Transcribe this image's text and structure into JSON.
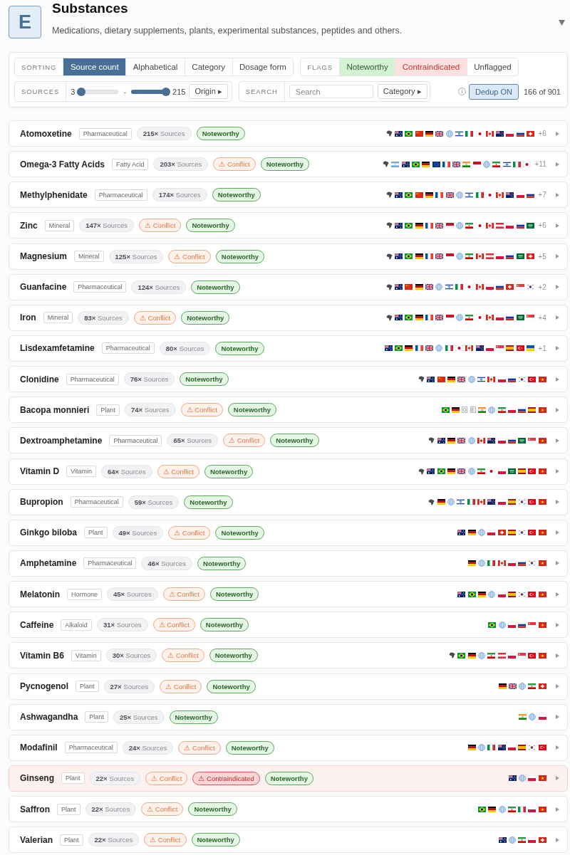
{
  "header": {
    "logo": "E",
    "title": "Substances",
    "subtitle": "Medications, dietary supplements, plants, experimental substances, peptides and others."
  },
  "sorting": {
    "label": "SORTING",
    "options": [
      {
        "label": "Source count",
        "selected": true
      },
      {
        "label": "Alphabetical",
        "selected": false
      },
      {
        "label": "Category",
        "selected": false
      },
      {
        "label": "Dosage form",
        "selected": false
      }
    ]
  },
  "flags_filter": {
    "label": "FLAGS",
    "options": [
      {
        "kind": "noteworthy",
        "label": "Noteworthy",
        "selected": true
      },
      {
        "kind": "contraindicated",
        "label": "Contraindicated",
        "selected": true
      },
      {
        "kind": "unflagged",
        "label": "Unflagged",
        "selected": false
      }
    ]
  },
  "sources": {
    "label": "SOURCES",
    "min": "3",
    "min_slider": {
      "level": 0
    },
    "separator": "-",
    "max_slider": {
      "level": 1
    },
    "max": "215",
    "origin_button": "Origin ▸"
  },
  "search": {
    "label": "SEARCH",
    "placeholder": "Search",
    "category_button": "Category ▸"
  },
  "dedup": {
    "label": "Dedup ON",
    "on": true
  },
  "count": "166 of 901",
  "rows": [
    {
      "name": "Atomoxetine",
      "category": "Pharmaceutical",
      "sources": "**215×** Sources",
      "highlighted": false,
      "tags": [
        {
          "kind": "noteworthy",
          "label": "Noteworthy"
        }
      ],
      "flags": [
        {
          "kind": "africa"
        },
        {
          "kind": "australia"
        },
        {
          "kind": "brazil"
        },
        {
          "kind": "china"
        },
        {
          "kind": "germany"
        },
        {
          "kind": "united-kingdom"
        },
        {
          "kind": "globe"
        },
        {
          "kind": "israel"
        },
        {
          "kind": "italy"
        },
        {
          "kind": "japan"
        },
        {
          "kind": "canada"
        },
        {
          "kind": "new-zealand"
        },
        {
          "kind": "poland"
        },
        {
          "kind": "russia"
        },
        {
          "kind": "switzerland"
        }
      ],
      "more": "+6"
    },
    {
      "name": "Omega-3 Fatty Acids",
      "category": "Fatty Acid",
      "sources": "**203×** Sources",
      "highlighted": false,
      "tags": [
        {
          "kind": "conflict",
          "label": "⚠ Conflict"
        },
        {
          "kind": "noteworthy",
          "label": "Noteworthy"
        }
      ],
      "flags": [
        {
          "kind": "africa"
        },
        {
          "kind": "argentina"
        },
        {
          "kind": "australia"
        },
        {
          "kind": "brazil"
        },
        {
          "kind": "germany"
        },
        {
          "kind": "european-union"
        },
        {
          "kind": "france"
        },
        {
          "kind": "united-kingdom"
        },
        {
          "kind": "india"
        },
        {
          "kind": "indonesia"
        },
        {
          "kind": "globe"
        },
        {
          "kind": "iran"
        },
        {
          "kind": "israel"
        },
        {
          "kind": "italy"
        },
        {
          "kind": "japan"
        }
      ],
      "more": "+11"
    },
    {
      "name": "Methylphenidate",
      "category": "Pharmaceutical",
      "sources": "**174×** Sources",
      "highlighted": false,
      "tags": [
        {
          "kind": "noteworthy",
          "label": "Noteworthy"
        }
      ],
      "flags": [
        {
          "kind": "africa"
        },
        {
          "kind": "australia"
        },
        {
          "kind": "brazil"
        },
        {
          "kind": "china"
        },
        {
          "kind": "germany"
        },
        {
          "kind": "france"
        },
        {
          "kind": "united-kingdom"
        },
        {
          "kind": "globe"
        },
        {
          "kind": "israel"
        },
        {
          "kind": "italy"
        },
        {
          "kind": "japan"
        },
        {
          "kind": "canada"
        },
        {
          "kind": "new-zealand"
        },
        {
          "kind": "poland"
        },
        {
          "kind": "russia"
        }
      ],
      "more": "+7"
    },
    {
      "name": "Zinc",
      "category": "Mineral",
      "sources": "**147×** Sources",
      "highlighted": false,
      "tags": [
        {
          "kind": "conflict",
          "label": "⚠ Conflict"
        },
        {
          "kind": "noteworthy",
          "label": "Noteworthy"
        }
      ],
      "flags": [
        {
          "kind": "africa"
        },
        {
          "kind": "australia"
        },
        {
          "kind": "brazil"
        },
        {
          "kind": "germany"
        },
        {
          "kind": "france"
        },
        {
          "kind": "united-kingdom"
        },
        {
          "kind": "indonesia"
        },
        {
          "kind": "globe"
        },
        {
          "kind": "iran"
        },
        {
          "kind": "japan"
        },
        {
          "kind": "canada"
        },
        {
          "kind": "austria"
        },
        {
          "kind": "poland"
        },
        {
          "kind": "russia"
        },
        {
          "kind": "saudi-arabia"
        }
      ],
      "more": "+6"
    },
    {
      "name": "Magnesium",
      "category": "Mineral",
      "sources": "**125×** Sources",
      "highlighted": false,
      "tags": [
        {
          "kind": "conflict",
          "label": "⚠ Conflict"
        },
        {
          "kind": "noteworthy",
          "label": "Noteworthy"
        }
      ],
      "flags": [
        {
          "kind": "africa"
        },
        {
          "kind": "australia"
        },
        {
          "kind": "brazil"
        },
        {
          "kind": "germany"
        },
        {
          "kind": "france"
        },
        {
          "kind": "united-kingdom"
        },
        {
          "kind": "indonesia"
        },
        {
          "kind": "globe"
        },
        {
          "kind": "iran"
        },
        {
          "kind": "canada"
        },
        {
          "kind": "austria"
        },
        {
          "kind": "poland"
        },
        {
          "kind": "russia"
        },
        {
          "kind": "saudi-arabia"
        },
        {
          "kind": "switzerland"
        }
      ],
      "more": "+5"
    },
    {
      "name": "Guanfacine",
      "category": "Pharmaceutical",
      "sources": "**124×** Sources",
      "highlighted": false,
      "tags": [
        {
          "kind": "noteworthy",
          "label": "Noteworthy"
        }
      ],
      "flags": [
        {
          "kind": "africa"
        },
        {
          "kind": "australia"
        },
        {
          "kind": "china"
        },
        {
          "kind": "germany"
        },
        {
          "kind": "united-kingdom"
        },
        {
          "kind": "globe"
        },
        {
          "kind": "israel"
        },
        {
          "kind": "italy"
        },
        {
          "kind": "japan"
        },
        {
          "kind": "canada"
        },
        {
          "kind": "poland"
        },
        {
          "kind": "russia"
        },
        {
          "kind": "switzerland"
        },
        {
          "kind": "singapore"
        },
        {
          "kind": "south-korea"
        }
      ],
      "more": "+2"
    },
    {
      "name": "Iron",
      "category": "Mineral",
      "sources": "**83×** Sources",
      "highlighted": false,
      "tags": [
        {
          "kind": "conflict",
          "label": "⚠ Conflict"
        },
        {
          "kind": "noteworthy",
          "label": "Noteworthy"
        }
      ],
      "flags": [
        {
          "kind": "africa"
        },
        {
          "kind": "australia"
        },
        {
          "kind": "brazil"
        },
        {
          "kind": "germany"
        },
        {
          "kind": "france"
        },
        {
          "kind": "united-kingdom"
        },
        {
          "kind": "indonesia"
        },
        {
          "kind": "globe"
        },
        {
          "kind": "iran"
        },
        {
          "kind": "japan"
        },
        {
          "kind": "canada"
        },
        {
          "kind": "poland"
        },
        {
          "kind": "russia"
        },
        {
          "kind": "saudi-arabia"
        },
        {
          "kind": "singapore"
        }
      ],
      "more": "+4"
    },
    {
      "name": "Lisdexamfetamine",
      "category": "Pharmaceutical",
      "sources": "**80×** Sources",
      "highlighted": false,
      "tags": [
        {
          "kind": "noteworthy",
          "label": "Noteworthy"
        }
      ],
      "flags": [
        {
          "kind": "australia"
        },
        {
          "kind": "brazil"
        },
        {
          "kind": "germany"
        },
        {
          "kind": "france"
        },
        {
          "kind": "united-kingdom"
        },
        {
          "kind": "globe"
        },
        {
          "kind": "italy"
        },
        {
          "kind": "japan"
        },
        {
          "kind": "canada"
        },
        {
          "kind": "new-zealand"
        },
        {
          "kind": "poland"
        },
        {
          "kind": "singapore"
        },
        {
          "kind": "spain"
        },
        {
          "kind": "turkey"
        },
        {
          "kind": "ukraine"
        }
      ],
      "more": "+1"
    },
    {
      "name": "Clonidine",
      "category": "Pharmaceutical",
      "sources": "**76×** Sources",
      "highlighted": false,
      "tags": [
        {
          "kind": "noteworthy",
          "label": "Noteworthy"
        }
      ],
      "flags": [
        {
          "kind": "africa"
        },
        {
          "kind": "australia"
        },
        {
          "kind": "china"
        },
        {
          "kind": "germany"
        },
        {
          "kind": "united-kingdom"
        },
        {
          "kind": "globe"
        },
        {
          "kind": "israel"
        },
        {
          "kind": "canada"
        },
        {
          "kind": "poland"
        },
        {
          "kind": "russia"
        },
        {
          "kind": "south-korea"
        },
        {
          "kind": "turkey"
        },
        {
          "kind": "vietnam"
        }
      ]
    },
    {
      "name": "Bacopa monnieri",
      "category": "Plant",
      "sources": "**74×** Sources",
      "highlighted": false,
      "tags": [
        {
          "kind": "conflict",
          "label": "⚠ Conflict"
        },
        {
          "kind": "noteworthy",
          "label": "Noteworthy"
        }
      ],
      "flags": [
        {
          "kind": "brazil"
        },
        {
          "kind": "germany"
        },
        {
          "kind": "letter",
          "text": "G"
        },
        {
          "kind": "letter",
          "text": "E"
        },
        {
          "kind": "india"
        },
        {
          "kind": "globe"
        },
        {
          "kind": "iran"
        },
        {
          "kind": "poland"
        },
        {
          "kind": "russia"
        },
        {
          "kind": "spain"
        },
        {
          "kind": "vietnam"
        }
      ]
    },
    {
      "name": "Dextroamphetamine",
      "category": "Pharmaceutical",
      "sources": "**65×** Sources",
      "highlighted": false,
      "tags": [
        {
          "kind": "conflict",
          "label": "⚠ Conflict"
        },
        {
          "kind": "noteworthy",
          "label": "Noteworthy"
        }
      ],
      "flags": [
        {
          "kind": "africa"
        },
        {
          "kind": "australia"
        },
        {
          "kind": "germany"
        },
        {
          "kind": "united-kingdom"
        },
        {
          "kind": "globe"
        },
        {
          "kind": "canada"
        },
        {
          "kind": "new-zealand"
        },
        {
          "kind": "poland"
        },
        {
          "kind": "russia"
        },
        {
          "kind": "saudi-arabia"
        },
        {
          "kind": "singapore"
        },
        {
          "kind": "vietnam"
        }
      ]
    },
    {
      "name": "Vitamin D",
      "category": "Vitamin",
      "sources": "**64×** Sources",
      "highlighted": false,
      "tags": [
        {
          "kind": "conflict",
          "label": "⚠ Conflict"
        },
        {
          "kind": "noteworthy",
          "label": "Noteworthy"
        }
      ],
      "flags": [
        {
          "kind": "africa"
        },
        {
          "kind": "australia"
        },
        {
          "kind": "brazil"
        },
        {
          "kind": "germany"
        },
        {
          "kind": "united-kingdom"
        },
        {
          "kind": "globe"
        },
        {
          "kind": "iran"
        },
        {
          "kind": "japan"
        },
        {
          "kind": "poland"
        },
        {
          "kind": "saudi-arabia"
        },
        {
          "kind": "spain"
        },
        {
          "kind": "turkey"
        },
        {
          "kind": "vietnam"
        }
      ]
    },
    {
      "name": "Bupropion",
      "category": "Pharmaceutical",
      "sources": "**59×** Sources",
      "highlighted": false,
      "tags": [
        {
          "kind": "noteworthy",
          "label": "Noteworthy"
        }
      ],
      "flags": [
        {
          "kind": "africa"
        },
        {
          "kind": "germany"
        },
        {
          "kind": "globe"
        },
        {
          "kind": "israel"
        },
        {
          "kind": "italy"
        },
        {
          "kind": "canada"
        },
        {
          "kind": "new-zealand"
        },
        {
          "kind": "poland"
        },
        {
          "kind": "spain"
        },
        {
          "kind": "south-korea"
        },
        {
          "kind": "turkey"
        },
        {
          "kind": "vietnam"
        }
      ]
    },
    {
      "name": "Ginkgo biloba",
      "category": "Plant",
      "sources": "**49×** Sources",
      "highlighted": false,
      "tags": [
        {
          "kind": "conflict",
          "label": "⚠ Conflict"
        },
        {
          "kind": "noteworthy",
          "label": "Noteworthy"
        }
      ],
      "flags": [
        {
          "kind": "australia"
        },
        {
          "kind": "germany"
        },
        {
          "kind": "globe"
        },
        {
          "kind": "poland"
        },
        {
          "kind": "switzerland"
        },
        {
          "kind": "spain"
        },
        {
          "kind": "south-korea"
        },
        {
          "kind": "turkey"
        },
        {
          "kind": "vietnam"
        }
      ]
    },
    {
      "name": "Amphetamine",
      "category": "Pharmaceutical",
      "sources": "**46×** Sources",
      "highlighted": false,
      "tags": [
        {
          "kind": "noteworthy",
          "label": "Noteworthy"
        }
      ],
      "flags": [
        {
          "kind": "germany"
        },
        {
          "kind": "globe"
        },
        {
          "kind": "italy"
        },
        {
          "kind": "canada"
        },
        {
          "kind": "poland"
        },
        {
          "kind": "russia"
        },
        {
          "kind": "south-korea"
        },
        {
          "kind": "vietnam"
        }
      ]
    },
    {
      "name": "Melatonin",
      "category": "Hormone",
      "sources": "**45×** Sources",
      "highlighted": false,
      "tags": [
        {
          "kind": "conflict",
          "label": "⚠ Conflict"
        },
        {
          "kind": "noteworthy",
          "label": "Noteworthy"
        }
      ],
      "flags": [
        {
          "kind": "australia"
        },
        {
          "kind": "brazil"
        },
        {
          "kind": "germany"
        },
        {
          "kind": "globe"
        },
        {
          "kind": "poland"
        },
        {
          "kind": "spain"
        },
        {
          "kind": "south-korea"
        },
        {
          "kind": "turkey"
        },
        {
          "kind": "vietnam"
        }
      ]
    },
    {
      "name": "Caffeine",
      "category": "Alkaloid",
      "sources": "**31×** Sources",
      "highlighted": false,
      "tags": [
        {
          "kind": "conflict",
          "label": "⚠ Conflict"
        },
        {
          "kind": "noteworthy",
          "label": "Noteworthy"
        }
      ],
      "flags": [
        {
          "kind": "brazil"
        },
        {
          "kind": "globe"
        },
        {
          "kind": "poland"
        },
        {
          "kind": "russia"
        },
        {
          "kind": "singapore"
        },
        {
          "kind": "vietnam"
        }
      ]
    },
    {
      "name": "Vitamin B6",
      "category": "Vitamin",
      "sources": "**30×** Sources",
      "highlighted": false,
      "tags": [
        {
          "kind": "conflict",
          "label": "⚠ Conflict"
        },
        {
          "kind": "noteworthy",
          "label": "Noteworthy"
        }
      ],
      "flags": [
        {
          "kind": "africa"
        },
        {
          "kind": "brazil"
        },
        {
          "kind": "germany"
        },
        {
          "kind": "globe"
        },
        {
          "kind": "iran"
        },
        {
          "kind": "austria"
        },
        {
          "kind": "poland"
        },
        {
          "kind": "singapore"
        },
        {
          "kind": "turkey"
        },
        {
          "kind": "vietnam"
        }
      ]
    },
    {
      "name": "Pycnogenol",
      "category": "Plant",
      "sources": "**27×** Sources",
      "highlighted": false,
      "tags": [
        {
          "kind": "conflict",
          "label": "⚠ Conflict"
        },
        {
          "kind": "noteworthy",
          "label": "Noteworthy"
        }
      ],
      "flags": [
        {
          "kind": "germany"
        },
        {
          "kind": "united-kingdom"
        },
        {
          "kind": "globe"
        },
        {
          "kind": "iran"
        },
        {
          "kind": "switzerland"
        }
      ]
    },
    {
      "name": "Ashwagandha",
      "category": "Plant",
      "sources": "**25×** Sources",
      "highlighted": false,
      "tags": [
        {
          "kind": "noteworthy",
          "label": "Noteworthy"
        }
      ],
      "flags": [
        {
          "kind": "india"
        },
        {
          "kind": "globe"
        },
        {
          "kind": "poland"
        }
      ]
    },
    {
      "name": "Modafinil",
      "category": "Pharmaceutical",
      "sources": "**24×** Sources",
      "highlighted": false,
      "tags": [
        {
          "kind": "conflict",
          "label": "⚠ Conflict"
        },
        {
          "kind": "noteworthy",
          "label": "Noteworthy"
        }
      ],
      "flags": [
        {
          "kind": "germany"
        },
        {
          "kind": "globe"
        },
        {
          "kind": "italy"
        },
        {
          "kind": "new-zealand"
        },
        {
          "kind": "poland"
        },
        {
          "kind": "spain"
        },
        {
          "kind": "south-korea"
        },
        {
          "kind": "turkey"
        }
      ]
    },
    {
      "name": "Ginseng",
      "category": "Plant",
      "sources": "**22×** Sources",
      "highlighted": true,
      "tags": [
        {
          "kind": "conflict",
          "label": "⚠ Conflict"
        },
        {
          "kind": "contraindicated",
          "label": "⚠ Contraindicated"
        },
        {
          "kind": "noteworthy",
          "label": "Noteworthy"
        }
      ],
      "flags": [
        {
          "kind": "australia"
        },
        {
          "kind": "globe"
        },
        {
          "kind": "poland"
        },
        {
          "kind": "vietnam"
        }
      ]
    },
    {
      "name": "Saffron",
      "category": "Plant",
      "sources": "**22×** Sources",
      "highlighted": false,
      "tags": [
        {
          "kind": "conflict",
          "label": "⚠ Conflict"
        },
        {
          "kind": "noteworthy",
          "label": "Noteworthy"
        }
      ],
      "flags": [
        {
          "kind": "brazil"
        },
        {
          "kind": "germany"
        },
        {
          "kind": "globe"
        },
        {
          "kind": "iran"
        },
        {
          "kind": "italy"
        },
        {
          "kind": "poland"
        },
        {
          "kind": "vietnam"
        }
      ]
    },
    {
      "name": "Valerian",
      "category": "Plant",
      "sources": "**22×** Sources",
      "highlighted": false,
      "tags": [
        {
          "kind": "conflict",
          "label": "⚠ Conflict"
        },
        {
          "kind": "noteworthy",
          "label": "Noteworthy"
        }
      ],
      "flags": [
        {
          "kind": "australia"
        },
        {
          "kind": "globe"
        },
        {
          "kind": "iran"
        },
        {
          "kind": "poland"
        },
        {
          "kind": "switzerland"
        }
      ]
    }
  ]
}
